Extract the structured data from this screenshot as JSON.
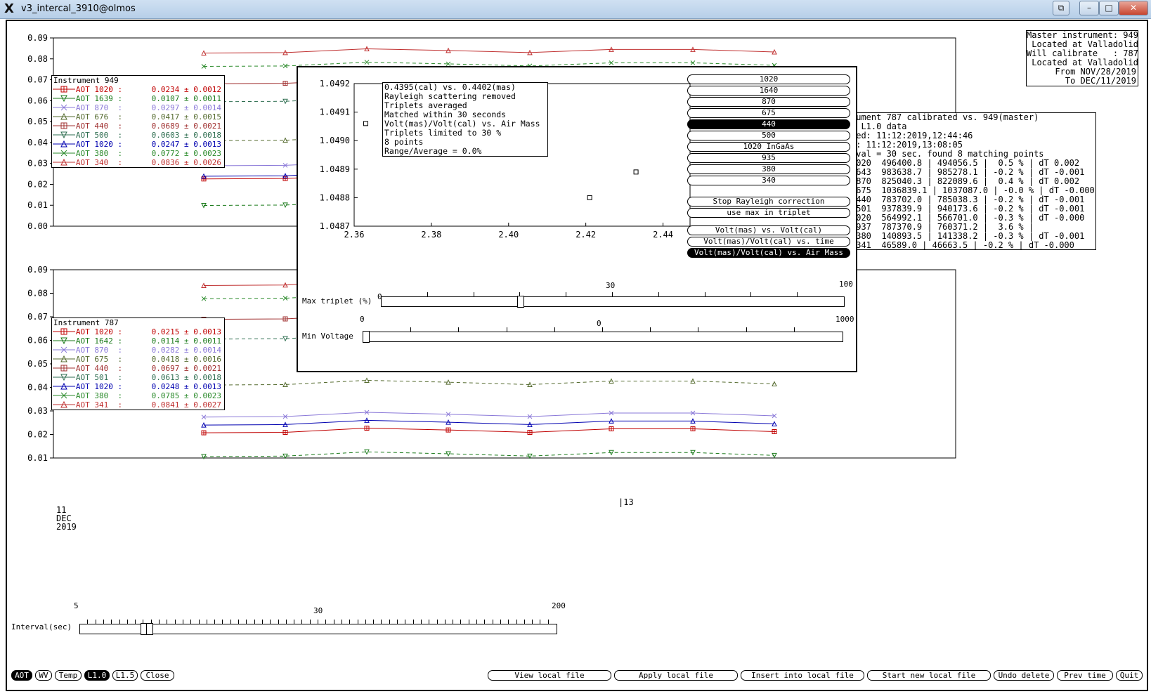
{
  "window": {
    "title": "v3_intercal_3910@olmos",
    "logo": "X",
    "controls": [
      "restore-icon",
      "minimize-icon",
      "maximize-icon",
      "close-icon"
    ]
  },
  "plot_top": {
    "y_ticks": [
      "0.09",
      "0.08",
      "0.07",
      "0.06",
      "0.05",
      "0.04",
      "0.03",
      "0.02",
      "0.01",
      "0.00"
    ],
    "legend": {
      "title": "Instrument 949",
      "entries": [
        {
          "label": "AOT 1020 :",
          "value": "0.0234 ± 0.0012",
          "color": "#c00000",
          "marker": "square"
        },
        {
          "label": "AOT 1639 :",
          "value": "0.0107 ± 0.0011",
          "color": "#1a7a1a",
          "marker": "tri-down"
        },
        {
          "label": "AOT 870  :",
          "value": "0.0297 ± 0.0014",
          "color": "#8a78d8",
          "marker": "x"
        },
        {
          "label": "AOT 676  :",
          "value": "0.0417 ± 0.0015",
          "color": "#556b2f",
          "marker": "tri-up"
        },
        {
          "label": "AOT 440  :",
          "value": "0.0689 ± 0.0021",
          "color": "#a03030",
          "marker": "square"
        },
        {
          "label": "AOT 500  :",
          "value": "0.0603 ± 0.0018",
          "color": "#2e6e50",
          "marker": "tri-down"
        },
        {
          "label": "AOT 1020 :",
          "value": "0.0247 ± 0.0013",
          "color": "#0000b0",
          "marker": "tri-up"
        },
        {
          "label": "AOT 380  :",
          "value": "0.0772 ± 0.0023",
          "color": "#2a8a2a",
          "marker": "x"
        },
        {
          "label": "AOT 340  :",
          "value": "0.0836 ± 0.0026",
          "color": "#c03030",
          "marker": "tri-up"
        }
      ]
    }
  },
  "plot_bottom": {
    "y_ticks": [
      "0.09",
      "0.08",
      "0.07",
      "0.06",
      "0.05",
      "0.04",
      "0.03",
      "0.02",
      "0.01"
    ],
    "legend": {
      "title": "Instrument 787",
      "entries": [
        {
          "label": "AOT 1020 :",
          "value": "0.0215 ± 0.0013",
          "color": "#c00000",
          "marker": "square"
        },
        {
          "label": "AOT 1642 :",
          "value": "0.0114 ± 0.0011",
          "color": "#1a7a1a",
          "marker": "tri-down"
        },
        {
          "label": "AOT 870  :",
          "value": "0.0282 ± 0.0014",
          "color": "#8a78d8",
          "marker": "x"
        },
        {
          "label": "AOT 675  :",
          "value": "0.0418 ± 0.0016",
          "color": "#556b2f",
          "marker": "tri-up"
        },
        {
          "label": "AOT 440  :",
          "value": "0.0697 ± 0.0021",
          "color": "#a03030",
          "marker": "square"
        },
        {
          "label": "AOT 501  :",
          "value": "0.0613 ± 0.0018",
          "color": "#2e6e50",
          "marker": "tri-down"
        },
        {
          "label": "AOT 1020 :",
          "value": "0.0248 ± 0.0013",
          "color": "#0000b0",
          "marker": "tri-up"
        },
        {
          "label": "AOT 380  :",
          "value": "0.0785 ± 0.0023",
          "color": "#2a8a2a",
          "marker": "x"
        },
        {
          "label": "AOT 341  :",
          "value": "0.0841 ± 0.0027",
          "color": "#c03030",
          "marker": "tri-up"
        }
      ]
    },
    "x_label_day": "|13",
    "date_lines": [
      "11",
      "DEC",
      "2019"
    ]
  },
  "master_info": [
    "Master instrument: 949",
    " Located at Valladolid",
    "Will calibrate   : 787",
    " Located at Valladolid",
    "     From NOV/28/2019",
    "       To DEC/11/2019"
  ],
  "calib_info": [
    "rument 787 calibrated vs. 949(master)",
    "g L1.0 data",
    "ted: 11:12:2019,12:44:46",
    "d: 11:12:2019,13:08:05",
    "rval = 30 sec. found 8 matching points",
    ".020  496400.8 | 494056.5 |  0.5 % | dT 0.002",
    ".643  983638.7 | 985278.1 | -0.2 % | dT -0.001",
    ".870  825040.3 | 822089.6 |  0.4 % | dT 0.002",
    ".675  1036839.1 | 1037087.0 | -0.0 % | dT -0.000",
    ".440  783702.0 | 785038.3 | -0.2 % | dT -0.001",
    ".501  937839.9 | 940173.6 | -0.2 % | dT -0.001",
    ".020  564992.1 | 566701.0 | -0.3 % | dT -0.000",
    ".937  787370.9 | 760371.2 |  3.6 % |",
    ".380  140893.5 | 141338.2 | -0.3 % | dT -0.001",
    ".341  46589.0 | 46663.5 | -0.2 % | dT -0.000"
  ],
  "dialog": {
    "info_lines": [
      "0.4395(cal) vs. 0.4402(mas)",
      "Rayleigh scattering removed",
      "Triplets averaged",
      "Matched within 30 seconds",
      "Volt(mas)/Volt(cal) vs. Air Mass",
      "Triplets limited to 30 %",
      "8 points",
      "Range/Average = 0.0%"
    ],
    "wavelength_buttons": [
      "1020",
      "1640",
      "870",
      "675",
      "440",
      "500",
      "1020 InGaAs",
      "935",
      "380",
      "340"
    ],
    "selected_wavelength": "440",
    "option_buttons": [
      "Stop Rayleigh correction",
      "use max in triplet"
    ],
    "mode_buttons": [
      "Volt(mas) vs. Volt(cal)",
      "Volt(mas)/Volt(cal) vs. time",
      "Volt(mas)/Volt(cal) vs. Air Mass"
    ],
    "selected_mode": "Volt(mas)/Volt(cal) vs. Air Mass",
    "max_triplet": {
      "label": "Max triplet (%)",
      "min": "0",
      "max": "100",
      "value": "30"
    },
    "min_voltage": {
      "label": "Min Voltage",
      "min": "0",
      "max": "1000",
      "value": "0"
    }
  },
  "chart_data": {
    "type": "scatter",
    "x_ticks": [
      "2.36",
      "2.38",
      "2.40",
      "2.42",
      "2.44"
    ],
    "y_ticks": [
      "1.0492",
      "1.0491",
      "1.0490",
      "1.0489",
      "1.0488",
      "1.0487"
    ],
    "xlim": [
      2.36,
      2.447
    ],
    "ylim": [
      1.0487,
      1.0492
    ],
    "points": [
      {
        "x": 2.363,
        "y": 1.04906
      },
      {
        "x": 2.408,
        "y": 1.04907
      },
      {
        "x": 2.421,
        "y": 1.0488
      },
      {
        "x": 2.433,
        "y": 1.04889
      }
    ]
  },
  "interval_slider": {
    "label": "Interval(sec)",
    "min": "5",
    "max": "200",
    "value": "30"
  },
  "bottom_bar": {
    "left_buttons": [
      "AOT",
      "WV",
      "Temp",
      "L1.0",
      "L1.5",
      "Close"
    ],
    "selected_left": [
      "AOT",
      "L1.0"
    ],
    "right_buttons": [
      "View local file",
      "Apply local file",
      "Insert into local file",
      "Start new local file",
      "Undo delete",
      "Prev time",
      "Quit"
    ]
  }
}
